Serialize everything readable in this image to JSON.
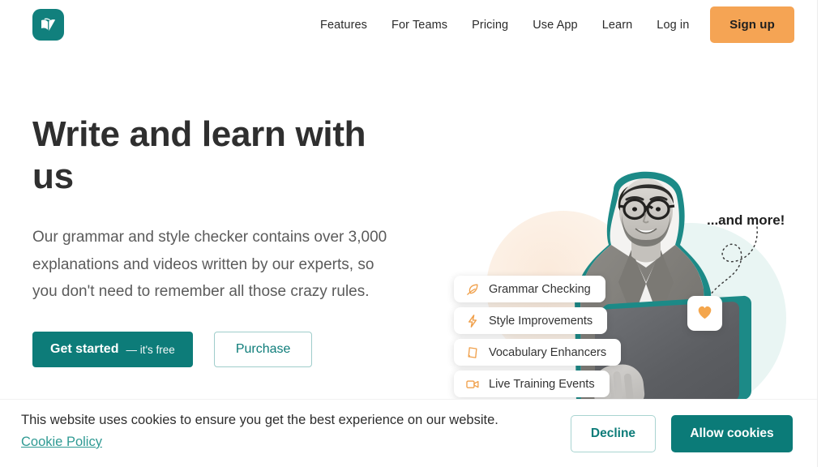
{
  "brand": {
    "logo_icon": "languagetool-book-check-icon",
    "primary_color": "#0d7c79",
    "accent_color": "#f5a454",
    "logo_bg": "#11807d"
  },
  "header": {
    "nav": [
      {
        "label": "Features"
      },
      {
        "label": "For Teams"
      },
      {
        "label": "Pricing"
      },
      {
        "label": "Use App"
      },
      {
        "label": "Learn"
      },
      {
        "label": "Log in"
      }
    ],
    "signup_label": "Sign up"
  },
  "hero": {
    "title": "Write and learn with us",
    "subtitle": "Our grammar and style checker contains over 3,000 explanations and videos written by our experts, so you don't need to remember all those crazy rules.",
    "primary_button": {
      "label": "Get started",
      "sublabel": "— it's free"
    },
    "secondary_button": {
      "label": "Purchase"
    }
  },
  "illustration": {
    "annotation": "...and more!",
    "heart_icon": "heart-icon",
    "features": [
      {
        "label": "Grammar Checking",
        "icon": "feather-pen-icon"
      },
      {
        "label": "Style Improvements",
        "icon": "lightning-bolt-icon"
      },
      {
        "label": "Vocabulary Enhancers",
        "icon": "book-icon"
      },
      {
        "label": "Live Training Events",
        "icon": "video-camera-icon"
      }
    ]
  },
  "cookie_banner": {
    "message": "This website uses cookies to ensure you get the best experience on our website.",
    "policy_link": "Cookie Policy",
    "decline_label": "Decline",
    "allow_label": "Allow cookies",
    "link_color": "#2f9a93"
  }
}
